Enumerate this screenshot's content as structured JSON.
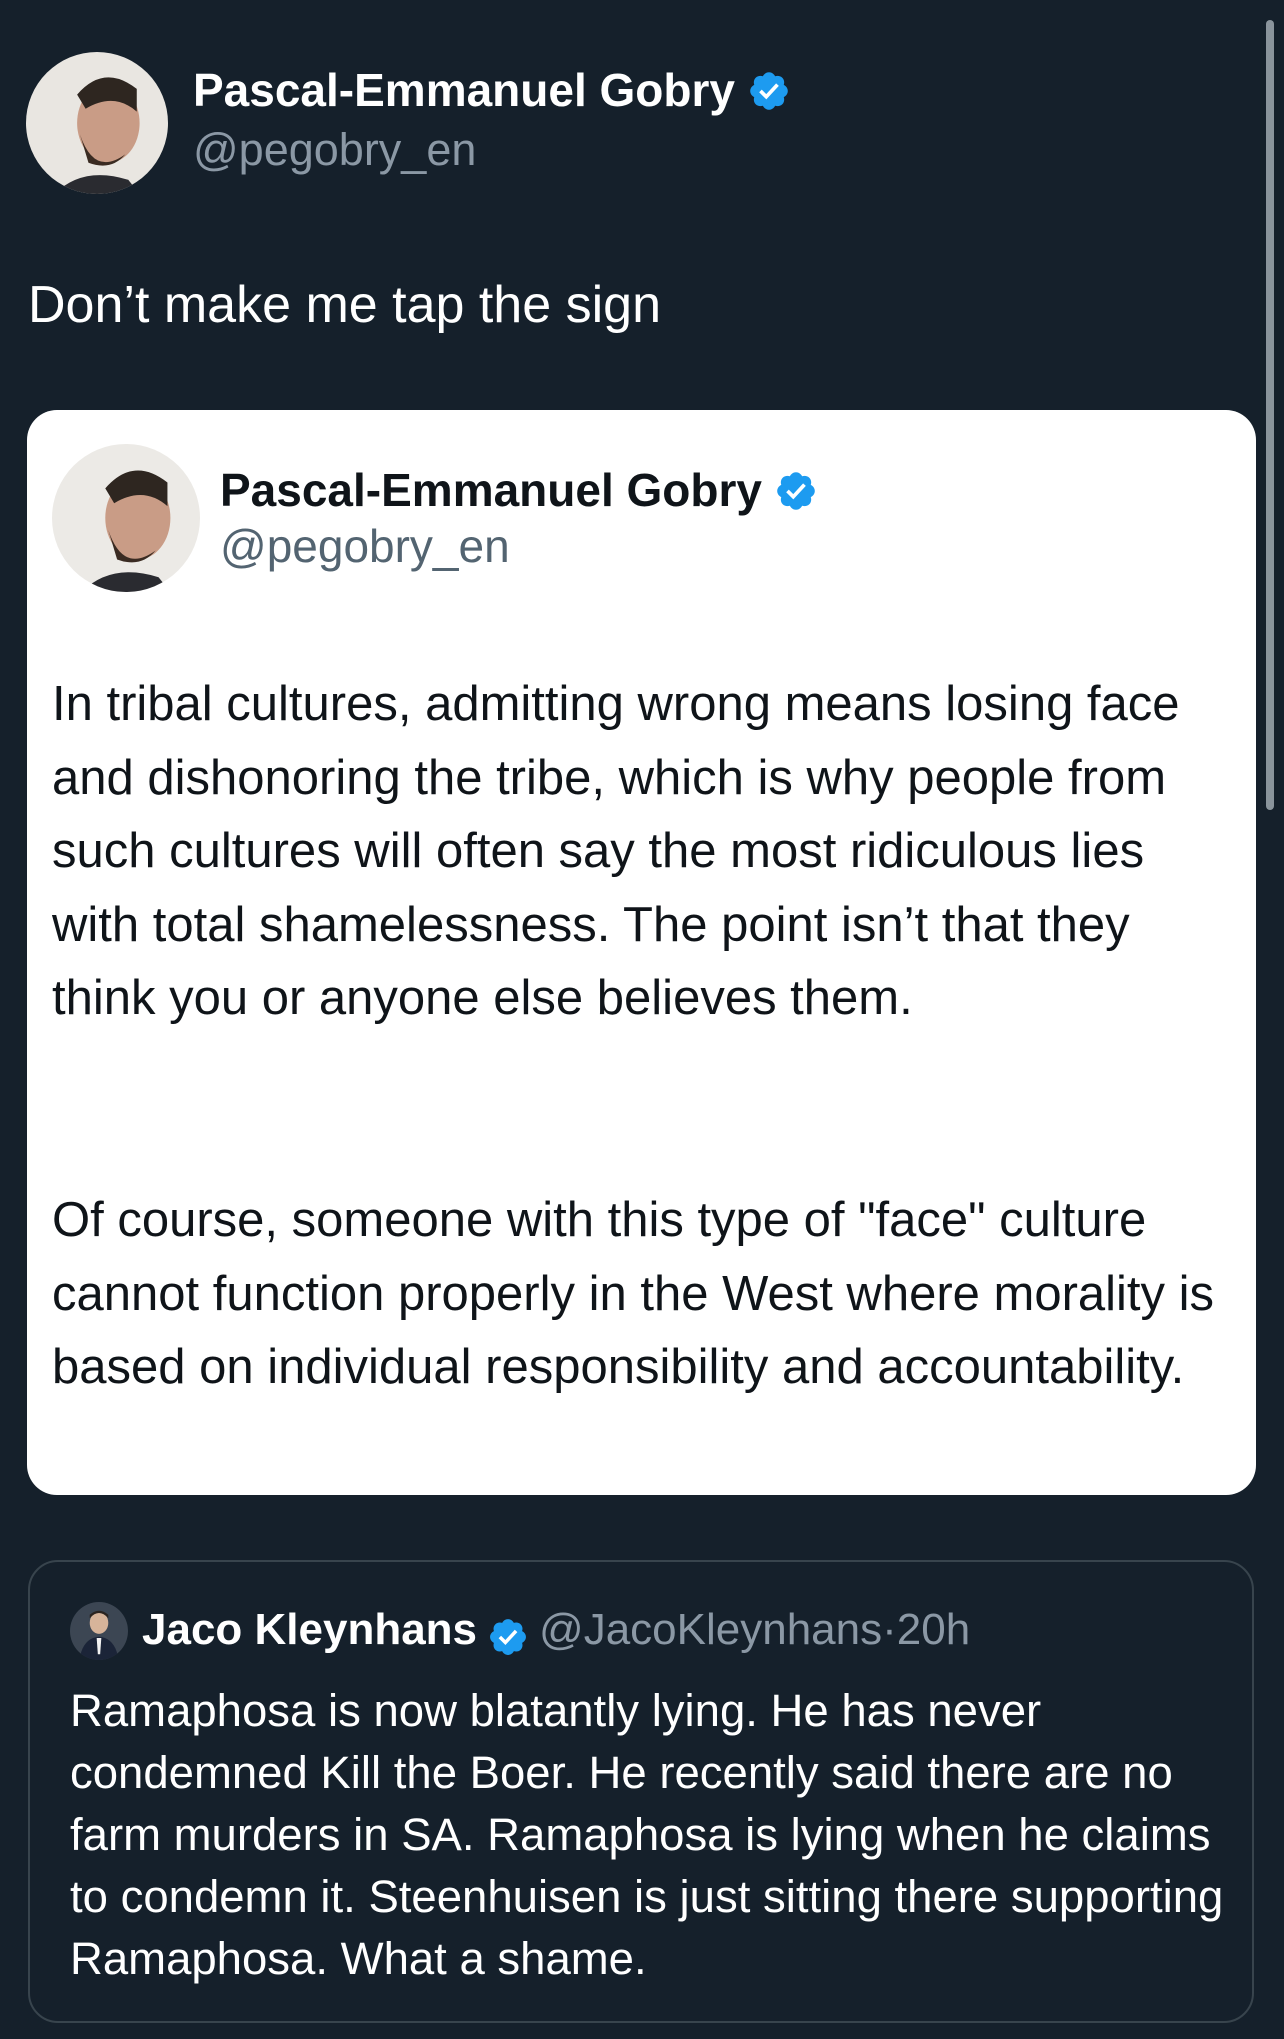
{
  "colors": {
    "background": "#15202b",
    "verified": "#1d9bf0",
    "card_bg": "#ffffff",
    "secondary_text": "#8b98a5",
    "border": "#38444d"
  },
  "tweet": {
    "author_name": "Pascal-Emmanuel Gobry",
    "author_handle": "@pegobry_en",
    "verified_icon": "verified-badge-icon",
    "text": "Don’t make me tap the sign"
  },
  "quoted_image": {
    "author_name": "Pascal-Emmanuel Gobry",
    "author_handle": "@pegobry_en",
    "paragraphs": [
      "In tribal cultures, admitting wrong means losing face and dishonoring the tribe, which is why people from such cultures will often say the most ridiculous lies with total shamelessness. The point isn’t that they think you or anyone else believes them.",
      "Of course, someone with this type of \"face\" culture cannot function properly in the West where morality is based on individual responsibility and accountability."
    ]
  },
  "quoted_tweet": {
    "author_name": "Jaco Kleynhans",
    "author_handle": "@JacoKleynhans",
    "separator": "·",
    "time": "20h",
    "text": "Ramaphosa is now blatantly lying. He has never condemned Kill the Boer. He recently said there are no farm murders in SA. Ramaphosa is lying when he claims to condemn it. Steenhuisen is just sitting there supporting Ramaphosa. What a shame."
  }
}
